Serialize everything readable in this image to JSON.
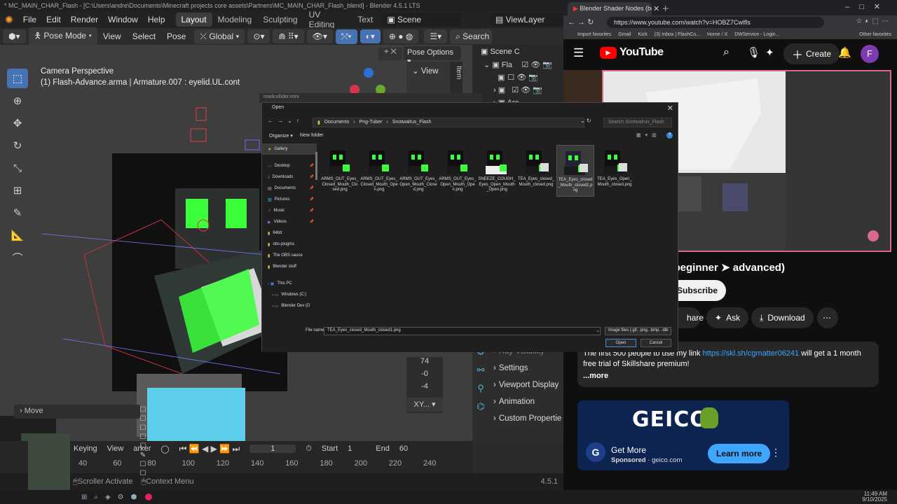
{
  "blender": {
    "title": "* MC_MAIN_CHAR_Flash - [C:\\Users\\andre\\Documents\\Minecraft projects core assets\\Partners\\MC_MAIN_CHAR_Flash_blend] - Blender 4.5.1 LTS",
    "menu": [
      "File",
      "Edit",
      "Render",
      "Window",
      "Help"
    ],
    "workspaces": [
      "Layout",
      "Modeling",
      "Sculpting",
      "UV Editing",
      "Text"
    ],
    "active_workspace": "Layout",
    "scene": "Scene",
    "view_layer": "ViewLayer",
    "mode": "Pose Mode",
    "header_menu": [
      "View",
      "Select",
      "Pose"
    ],
    "orientation": "Global",
    "search": "Search",
    "pose_options": "Pose Options",
    "viewport_title": "Camera Perspective",
    "viewport_sub": "(1) Flash-Advance.arma | Armature.007 : eyelid.UL.cont",
    "npanel_view": "View",
    "npanel_tab": "Item",
    "outliner_title": "Scene C",
    "outliner_rows": [
      "Fla",
      "",
      "",
      "Arc"
    ],
    "props_items": [
      "Ray Visibility",
      "Settings",
      "Viewport Display",
      "Animation",
      "Custom Propertie"
    ],
    "transform_values": [
      "74",
      "-0",
      "-4"
    ],
    "rotation_mode": "XY...",
    "move_panel": "Move",
    "timeline_menu": [
      "ck",
      "Keying",
      "View",
      "arker"
    ],
    "current_frame": "1",
    "start_label": "Start",
    "start": "1",
    "end_label": "End",
    "end": "60",
    "ruler": [
      "40",
      "60",
      "80",
      "100",
      "120",
      "140",
      "160",
      "180",
      "200",
      "220",
      "240"
    ],
    "status_items": [
      "Scroller Activate",
      "Context Menu"
    ],
    "version": "4.5.1"
  },
  "dialog": {
    "bg_title": "readcollider.mini",
    "title": "Open",
    "breadcrumb": [
      "Documents",
      "Png-Tuber",
      "Snotwalrus_Flash"
    ],
    "search_placeholder": "Search Snotwalrus_Flash",
    "organize": "Organize",
    "new_folder": "New folder",
    "sidebar": [
      "Gallery",
      "Desktop",
      "Downloads",
      "Documents",
      "Pictures",
      "Music",
      "Videos",
      "64bit",
      "obs-plugins",
      "The OBS sauce",
      "Blender stuff",
      "This PC",
      "Windows (C:)",
      "Blender Dev (D"
    ],
    "files": [
      "ARMS_OUT_Eyes_Closed_Mouth_Closed.png",
      "ARMS_OUT_Eyes_Closed_Mouth_Open.png",
      "ARMS_OUT_Eyes_Open_Mouth_Closed.png",
      "ARMS_OUT_Eyes_Open_Mouth_Open.png",
      "SNEEZE_COUGH_Eyes_Open_Mouth_Open.png",
      "TEA_Eyes_closed_Mouth_closed.png",
      "TEA_Eyes_closed_Mouth_closed1.png",
      "TEA_Eyes_Open_Mouth_closed.png"
    ],
    "selected_index": 6,
    "file_name_label": "File name:",
    "file_name": "TEA_Eyes_closed_Mouth_closed1.png",
    "file_type": "Image files (.gif, .png, .bmp, .dib",
    "open": "Open",
    "cancel": "Cancel"
  },
  "browser": {
    "tab_title": "Blender Shader Nodes (beg...",
    "url": "https://www.youtube.com/watch?v=HOBZ7Cwlfls",
    "bookmarks": [
      "Import favorites",
      "Gmail",
      "Kick",
      "(3) Inbox | FlashCo...",
      "Home / X",
      "DWService - Login...",
      "Other favorites"
    ],
    "brand": "YouTube",
    "create": "Create",
    "avatar": "F",
    "video_title": "s (beginner ➤ advanced)",
    "subscribe": "Subscribe",
    "share": "hare",
    "ask": "Ask",
    "download": "Download",
    "desc_pre": "The first 500 people to use my link ",
    "desc_link": "https://skl.sh/cgmatter06241",
    "desc_post": " will get a 1 month free trial of Skillshare premium!",
    "more": "...more",
    "ad_brand": "GEICO",
    "ad_title": "Get More",
    "ad_sponsored": "Sponsored",
    "ad_domain": "geico.com",
    "learn_more": "Learn more"
  },
  "taskbar": {
    "time": "11:49 AM",
    "date": "9/10/2025"
  },
  "colors": {
    "accent": "#4772b3",
    "yt_red": "#ff0000",
    "link": "#3ea6ff",
    "green": "#3cff3c"
  }
}
